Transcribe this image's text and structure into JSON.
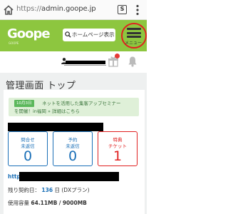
{
  "browser": {
    "url_scheme": "https://",
    "url_host": "admin.goope.jp",
    "tab_count": "S",
    "icons": [
      "home-icon",
      "tab-counter-icon",
      "kebab-menu-icon"
    ]
  },
  "header": {
    "logo_text": "Goope",
    "logo_sub": "GOOPE",
    "homepage_button": "ホームページ表示",
    "menu_label": "メニュー",
    "accent_color": "#8dc63f",
    "highlight_color": "#e02020"
  },
  "user_row": {
    "icons": [
      "person-icon",
      "gift-icon",
      "bell-icon"
    ]
  },
  "main": {
    "title": "管理画面 トップ",
    "notice": {
      "date": "10月3日",
      "line1": "ネットを活用した集客アップセミナー",
      "line2": "を開催！in福岡 » 詳細はこちら"
    },
    "stats": [
      {
        "label1": "問合せ",
        "label2": "未返信",
        "value": "0",
        "color": "#1a6fb7"
      },
      {
        "label1": "予約",
        "label2": "未返信",
        "value": "0",
        "color": "#1a6fb7"
      },
      {
        "label1": "特典",
        "label2": "チケット",
        "value": "1",
        "color": "#e02020"
      }
    ],
    "url_prefix": "http://",
    "contract": {
      "label": "残り契約日：",
      "days": "136",
      "unit": "日",
      "plan": "(DXプラン)"
    },
    "usage": {
      "label": "使用容量",
      "used": "64.11MB",
      "separator": "/",
      "total": "9000MB"
    }
  }
}
